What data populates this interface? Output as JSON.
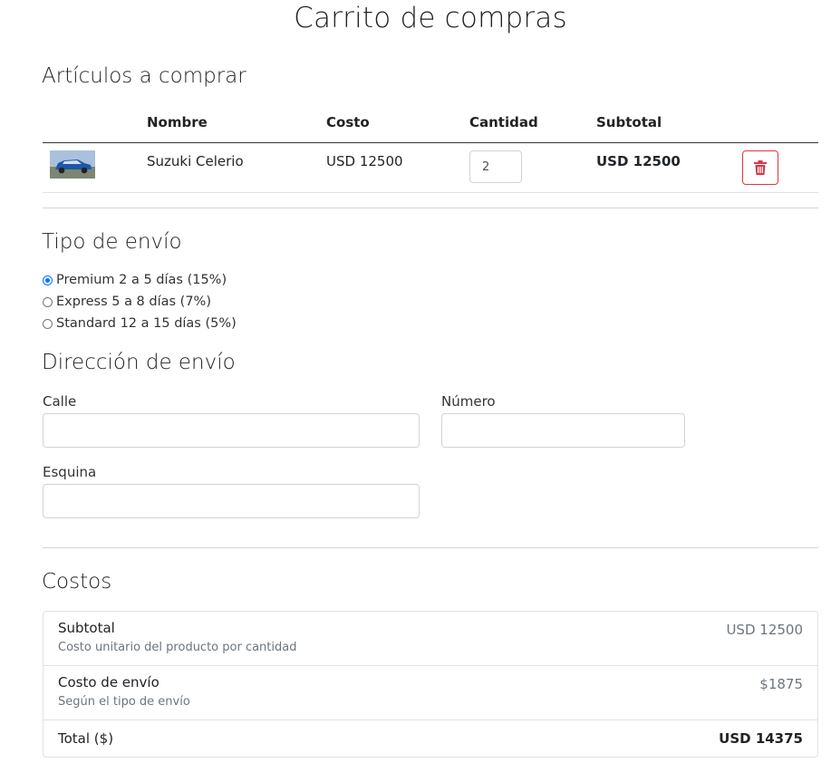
{
  "page_title": "Carrito de compras",
  "items_section": {
    "heading": "Artículos a comprar",
    "columns": [
      "Nombre",
      "Costo",
      "Cantidad",
      "Subtotal"
    ],
    "rows": [
      {
        "name": "Suzuki Celerio",
        "cost": "USD 12500",
        "quantity": "2",
        "subtotal": "USD 12500"
      }
    ]
  },
  "shipping_type": {
    "heading": "Tipo de envío",
    "options": [
      {
        "label": "Premium 2 a 5 días (15%)",
        "checked": true
      },
      {
        "label": "Express 5 a 8 días (7%)",
        "checked": false
      },
      {
        "label": "Standard 12 a 15 días (5%)",
        "checked": false
      }
    ]
  },
  "address": {
    "heading": "Dirección de envío",
    "street_label": "Calle",
    "number_label": "Número",
    "corner_label": "Esquina",
    "street_value": "",
    "number_value": "",
    "corner_value": ""
  },
  "costs": {
    "heading": "Costos",
    "subtotal_label": "Subtotal",
    "subtotal_desc": "Costo unitario del producto por cantidad",
    "subtotal_value": "USD 12500",
    "shipping_label": "Costo de envío",
    "shipping_desc": "Según el tipo de envío",
    "shipping_value": "$1875",
    "total_label": "Total ($)",
    "total_value": "USD 14375"
  },
  "colors": {
    "danger": "#dc3545",
    "radio_accent": "#0075ff",
    "border": "#dee2e6"
  },
  "icons": {
    "delete": "trash-icon",
    "product_image": "car-thumbnail"
  }
}
